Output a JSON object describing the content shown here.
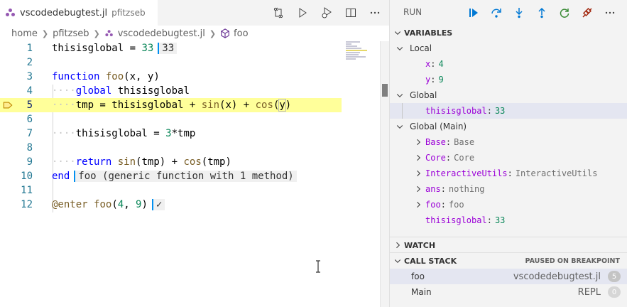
{
  "tab": {
    "filename": "vscodedebugtest.jl",
    "description": "pfitzseb"
  },
  "editor_actions": [
    "source-control-compare-icon",
    "run-icon",
    "debug-run-icon",
    "split-editor-icon",
    "more-actions-icon"
  ],
  "breadcrumb": {
    "items": [
      "home",
      "pfitzseb",
      "vscodedebugtest.jl",
      "foo"
    ]
  },
  "editor": {
    "line_numbers": [
      "1",
      "2",
      "3",
      "4",
      "5",
      "6",
      "7",
      "8",
      "9",
      "10",
      "11",
      "12"
    ],
    "current_line": "5",
    "inline_results": {
      "line1": "33",
      "line10": "foo (generic function with 1 method)",
      "line12": "✓"
    }
  },
  "debug": {
    "title": "RUN",
    "actions": [
      "continue-icon",
      "step-over-icon",
      "step-into-icon",
      "step-out-icon",
      "restart-icon",
      "disconnect-icon",
      "more-icon"
    ],
    "colors": {
      "continue": "#0078d4",
      "step": "#0078d4",
      "restart": "#388a34",
      "disconnect": "#a1260d"
    }
  },
  "variables": {
    "header": "VARIABLES",
    "local": {
      "label": "Local",
      "items": [
        {
          "name": "x",
          "value": "4"
        },
        {
          "name": "y",
          "value": "9"
        }
      ]
    },
    "global": {
      "label": "Global",
      "items": [
        {
          "name": "thisisglobal",
          "value": "33"
        }
      ]
    },
    "global_main": {
      "label": "Global (Main)",
      "items": [
        {
          "name": "Base",
          "value": "Base"
        },
        {
          "name": "Core",
          "value": "Core"
        },
        {
          "name": "InteractiveUtils",
          "value": "InteractiveUtils"
        },
        {
          "name": "ans",
          "value": "nothing"
        },
        {
          "name": "foo",
          "value": "foo"
        },
        {
          "name": "thisisglobal",
          "value": "33"
        }
      ]
    }
  },
  "watch": {
    "header": "WATCH"
  },
  "call_stack": {
    "header": "CALL STACK",
    "status": "PAUSED ON BREAKPOINT",
    "frames": [
      {
        "name": "foo",
        "file": "vscodedebugtest.jl",
        "line": "5"
      },
      {
        "name": "Main",
        "file": "REPL",
        "line": "0"
      }
    ]
  }
}
